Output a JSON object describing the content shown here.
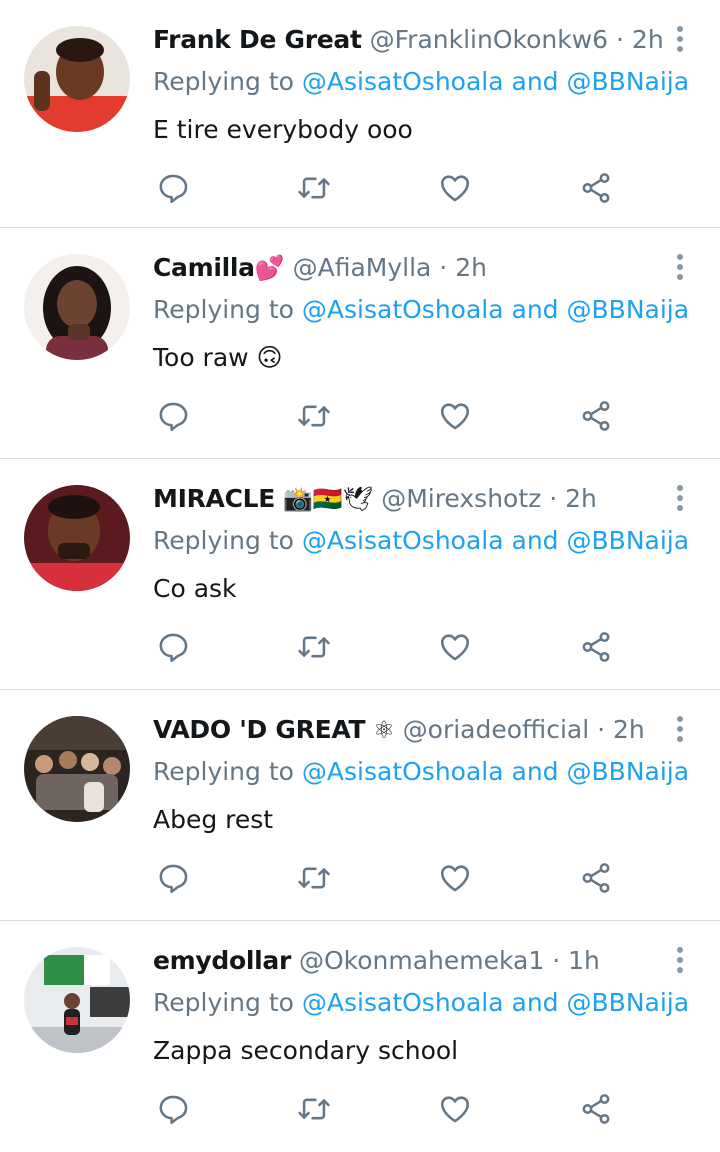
{
  "colors": {
    "link": "#1da1f2",
    "muted": "#657786",
    "text": "#14171a",
    "divider": "#d9dde0",
    "icon": "#657786"
  },
  "icons": [
    "reply-icon",
    "retweet-icon",
    "like-icon",
    "share-icon",
    "more-options-icon"
  ],
  "tweets": [
    {
      "name": "Frank De Great",
      "name_emoji": "",
      "handle": "@FranklinOkonkw6",
      "separator": "·",
      "time": "2h",
      "replying_prefix": "Replying to",
      "mention1": "@AsisatOshoala",
      "conjunction": "and",
      "mention2": "@BBNaija",
      "text": "E tire everybody ooo"
    },
    {
      "name": "Camilla",
      "name_emoji": "💕",
      "handle": "@AfiaMylla",
      "separator": "·",
      "time": "2h",
      "replying_prefix": "Replying to",
      "mention1": "@AsisatOshoala",
      "conjunction": "and",
      "mention2": "@BBNaija",
      "text": "Too raw 🙃"
    },
    {
      "name": "MIRACLE",
      "name_emoji": "📸🇬🇭🕊",
      "handle": "@Mirexshotz",
      "separator": "·",
      "time": "2h",
      "replying_prefix": "Replying to",
      "mention1": "@AsisatOshoala",
      "conjunction": "and",
      "mention2": "@BBNaija",
      "text": "Co ask"
    },
    {
      "name": "VADO 'D GREAT",
      "name_emoji": "⚛",
      "handle": "@oriadeofficial",
      "separator": "·",
      "time": "2h",
      "replying_prefix": "Replying to",
      "mention1": "@AsisatOshoala",
      "conjunction": "and",
      "mention2": "@BBNaija",
      "text": "Abeg rest"
    },
    {
      "name": "emydollar",
      "name_emoji": "",
      "handle": "@Okonmahemeka1",
      "separator": "·",
      "time": "1h",
      "replying_prefix": "Replying to",
      "mention1": "@AsisatOshoala",
      "conjunction": "and",
      "mention2": "@BBNaija",
      "text": "Zappa secondary school"
    }
  ]
}
